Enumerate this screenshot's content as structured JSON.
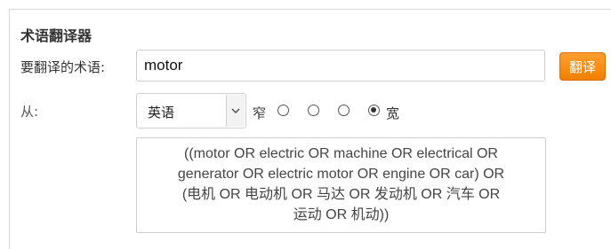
{
  "panel": {
    "title": "术语翻译器"
  },
  "term": {
    "label": "要翻译的术语:",
    "value": "motor",
    "translate_button": "翻译"
  },
  "source": {
    "label": "从:",
    "language_selected": "英语",
    "dropdown_icon": "chevron-down-icon"
  },
  "breadth": {
    "narrow_label": "窄",
    "wide_label": "宽",
    "options": [
      {
        "checked": false
      },
      {
        "checked": false
      },
      {
        "checked": false
      },
      {
        "checked": true
      }
    ]
  },
  "result": {
    "query_text": "((motor OR electric OR machine OR electrical OR\ngenerator OR electric motor OR engine OR car) OR\n(电机 OR 电动机 OR 马达 OR 发动机 OR 汽车 OR\n运动 OR 机动))"
  },
  "colors": {
    "accent": "#f58a07",
    "border": "#cfcfcf"
  }
}
